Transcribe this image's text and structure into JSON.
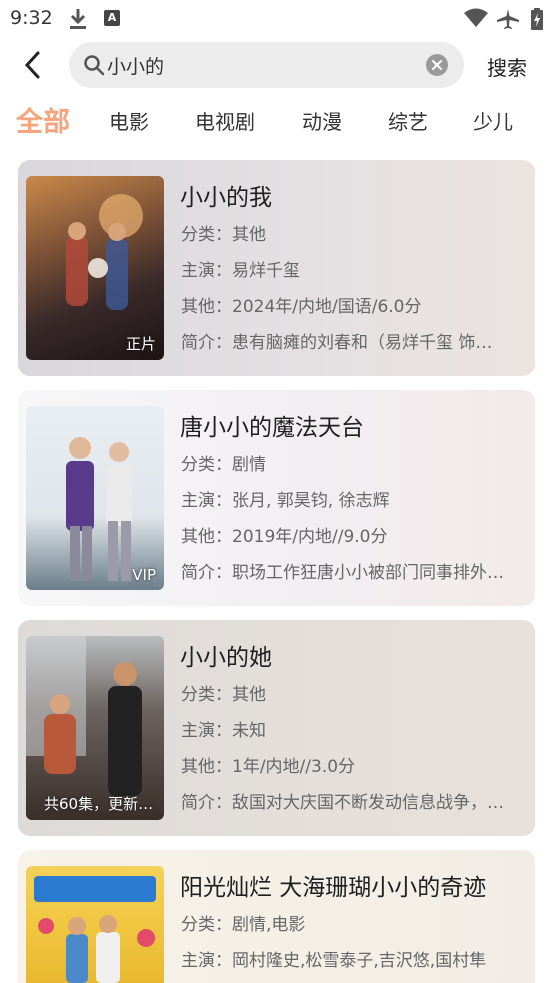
{
  "status_bar": {
    "time": "9:32",
    "icons": [
      "download-icon",
      "a-notification-icon",
      "wifi-icon",
      "airplane-icon",
      "battery-charging-icon"
    ]
  },
  "search": {
    "query": "小小的",
    "button_label": "搜索"
  },
  "categories": [
    "全部",
    "电影",
    "电视剧",
    "动漫",
    "综艺",
    "少儿"
  ],
  "active_category": "全部",
  "colors": {
    "accent": "#f5a47c",
    "search_bg": "#ececec"
  },
  "results": [
    {
      "title": "小小的我",
      "badge": "正片",
      "lines": [
        "分类：其他",
        "主演：易烊千玺",
        "其他：2024年/内地/国语/6.0分",
        "简介：患有脑瘫的刘春和（易烊千玺 饰…"
      ]
    },
    {
      "title": "唐小小的魔法天台",
      "badge": "VIP",
      "lines": [
        "分类：剧情",
        "主演：张月, 郭昊钧, 徐志辉",
        "其他：2019年/内地//9.0分",
        "简介：职场工作狂唐小小被部门同事排外…"
      ]
    },
    {
      "title": "小小的她",
      "badge": "共60集，更新…",
      "lines": [
        "分类：其他",
        "主演：未知",
        "其他：1年/内地//3.0分",
        "简介：敌国对大庆国不断发动信息战争，…"
      ]
    },
    {
      "title": "阳光灿烂 大海珊瑚小小的奇迹",
      "badge": "",
      "lines": [
        "分类：剧情,电影",
        "主演：岡村隆史,松雪泰子,吉沢悠,国村隼"
      ]
    }
  ]
}
